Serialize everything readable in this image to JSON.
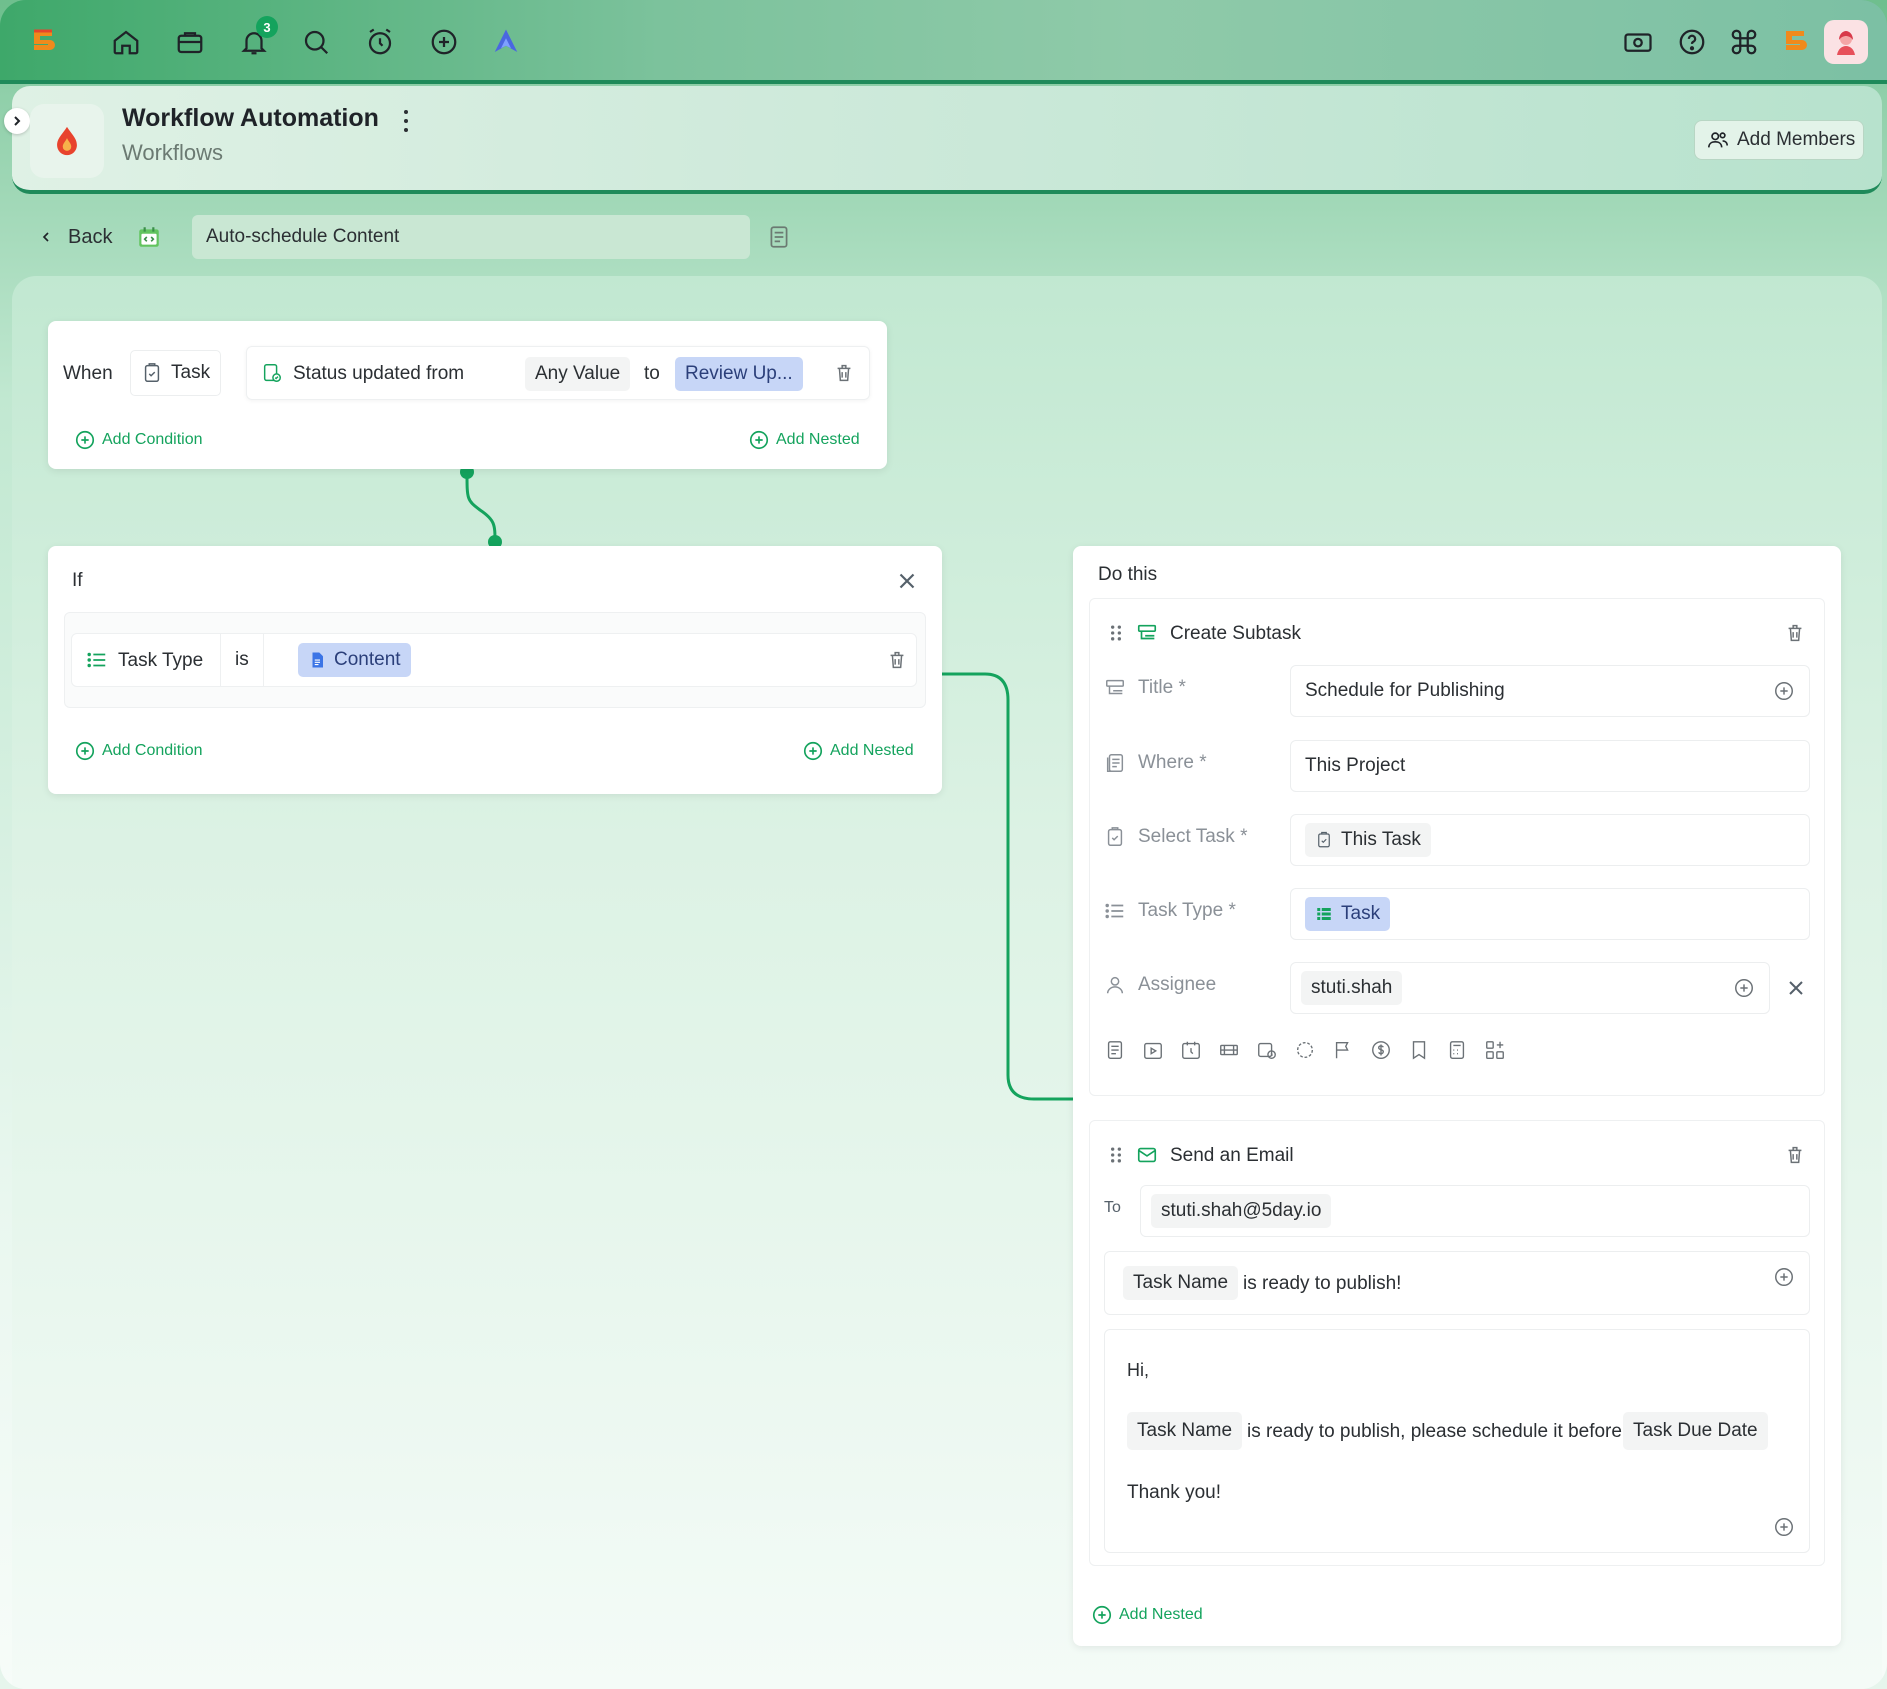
{
  "topnav": {
    "notifications_count": "3",
    "left_icons": [
      "app-logo-icon",
      "home-icon",
      "briefcase-icon",
      "bell-icon",
      "search-icon",
      "alarm-icon",
      "plus-circle-icon",
      "arrow-logo-icon"
    ],
    "right_icons": [
      "money-icon",
      "help-icon",
      "command-icon",
      "brand-logo-icon",
      "user-avatar"
    ]
  },
  "header": {
    "title": "Workflow Automation",
    "subtitle": "Workflows",
    "add_members_label": "Add Members"
  },
  "toolbar": {
    "back_label": "Back",
    "workflow_name": "Auto-schedule Content"
  },
  "when_block": {
    "label": "When",
    "entity": "Task",
    "trigger": "Status updated from",
    "from_value": "Any Value",
    "to_label": "to",
    "to_value": "Review Up...",
    "add_condition": "Add Condition",
    "add_nested": "Add Nested"
  },
  "if_block": {
    "label": "If",
    "field": "Task Type",
    "operator": "is",
    "value": "Content",
    "add_condition": "Add Condition",
    "add_nested": "Add Nested"
  },
  "do_block": {
    "label": "Do this",
    "create_subtask": {
      "title": "Create Subtask",
      "fields": {
        "title_label": "Title *",
        "title_value": "Schedule for Publishing",
        "where_label": "Where *",
        "where_value": "This Project",
        "select_task_label": "Select Task *",
        "select_task_value": "This Task",
        "task_type_label": "Task Type *",
        "task_type_value": "Task",
        "assignee_label": "Assignee",
        "assignee_value": "stuti.shah"
      }
    },
    "send_email": {
      "title": "Send an Email",
      "to_label": "To",
      "to_value": "stuti.shah@5day.io",
      "subject_token": "Task Name",
      "subject_text": "is ready to publish!",
      "body_greeting": "Hi,",
      "body_token_1": "Task Name",
      "body_text": "is ready to publish, please schedule it before",
      "body_token_2": "Task Due Date",
      "body_closing": "Thank you!"
    },
    "add_nested": "Add Nested"
  },
  "colors": {
    "accent_green": "#14a35d",
    "chip_blue": "#c7d6f7"
  }
}
